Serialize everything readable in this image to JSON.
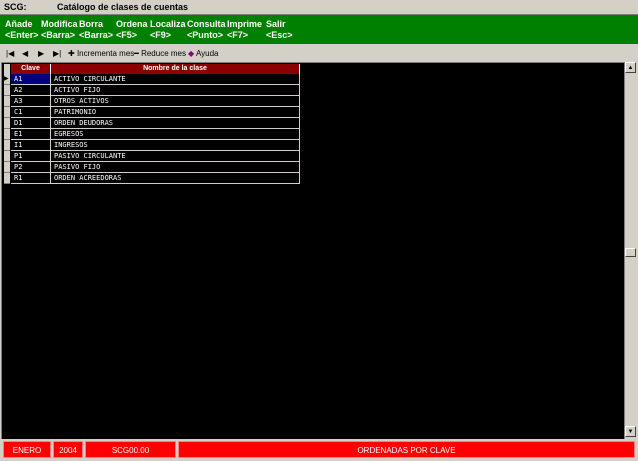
{
  "window": {
    "app": "SCG:",
    "title": "Catálogo de clases de cuentas"
  },
  "menu": [
    {
      "label": "Añade",
      "key": "<Enter>"
    },
    {
      "label": "Modifica",
      "key": "<Barra>"
    },
    {
      "label": "Borra",
      "key": "<Barra>"
    },
    {
      "label": "Ordena",
      "key": "<F5>"
    },
    {
      "label": "Localiza",
      "key": "<F9>"
    },
    {
      "label": "Consulta",
      "key": "<Punto>"
    },
    {
      "label": "Imprime",
      "key": "<F7>"
    },
    {
      "label": "Salir",
      "key": "<Esc>"
    }
  ],
  "toolbar": {
    "first_icon": "first-record-icon",
    "prev_icon": "previous-record-icon",
    "next_icon": "next-record-icon",
    "last_icon": "last-record-icon",
    "increment": "Incrementa mes",
    "reduce": "Reduce mes",
    "help": "Ayuda"
  },
  "grid": {
    "headers": [
      "Clave",
      "Nombre de la clase"
    ],
    "rows": [
      {
        "clave": "A1",
        "nombre": "ACTIVO CIRCULANTE"
      },
      {
        "clave": "A2",
        "nombre": "ACTIVO FIJO"
      },
      {
        "clave": "A3",
        "nombre": "OTROS ACTIVOS"
      },
      {
        "clave": "C1",
        "nombre": "PATRIMONIO"
      },
      {
        "clave": "D1",
        "nombre": "ORDEN DEUDORAS"
      },
      {
        "clave": "E1",
        "nombre": "EGRESOS"
      },
      {
        "clave": "I1",
        "nombre": "INGRESOS"
      },
      {
        "clave": "P1",
        "nombre": "PASIVO CIRCULANTE"
      },
      {
        "clave": "P2",
        "nombre": "PASIVO FIJO"
      },
      {
        "clave": "R1",
        "nombre": "ORDEN ACREEDORAS"
      }
    ]
  },
  "status": {
    "month": "ENERO",
    "year": "2004",
    "code": "SCG00.00",
    "message": "ORDENADAS POR CLAVE"
  },
  "colors": {
    "menu_bg": "#008000",
    "header_bg": "#8b0000",
    "status_bg": "#ff0000",
    "grid_bg": "#000000"
  }
}
